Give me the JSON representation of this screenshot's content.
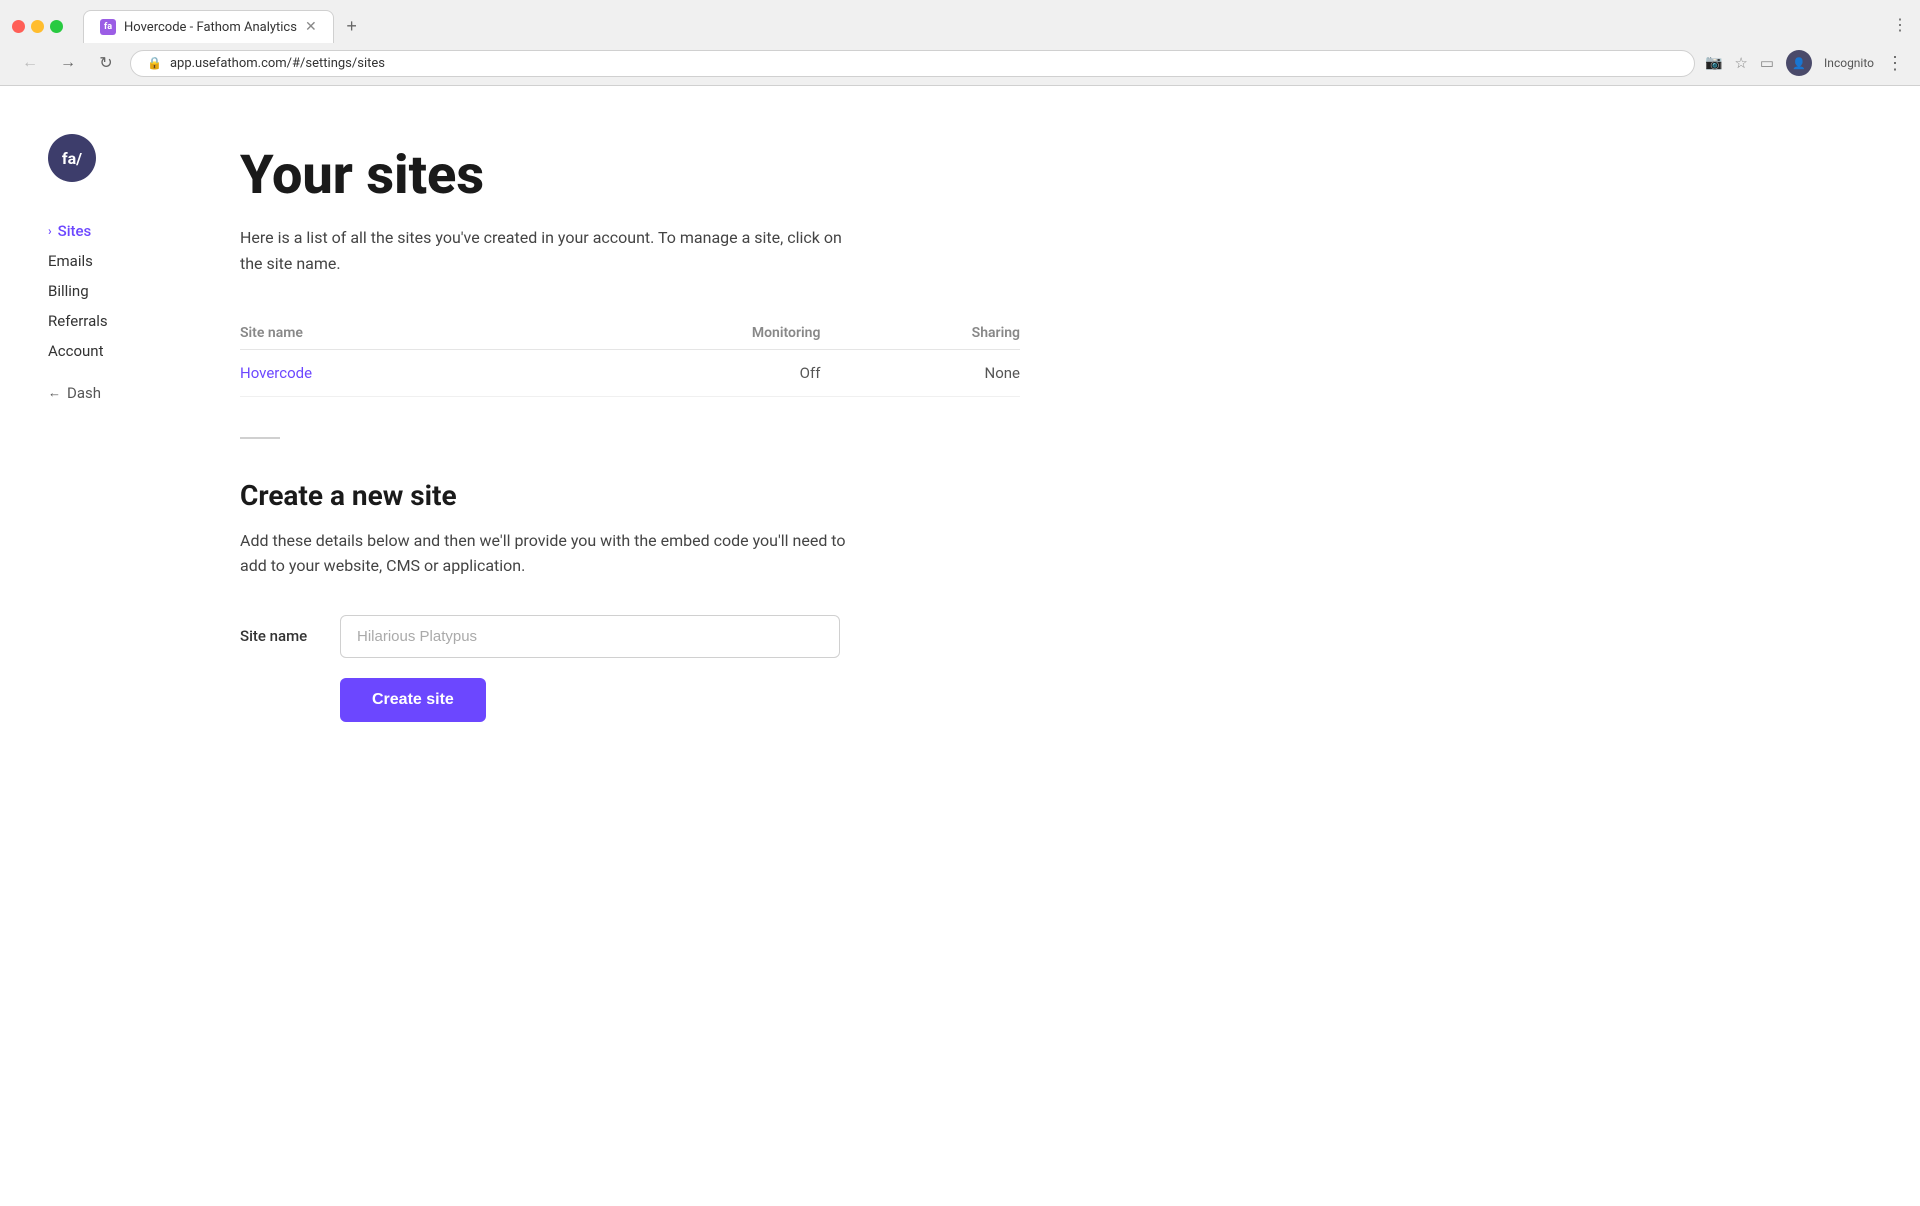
{
  "browser": {
    "tab_title": "Hovercode - Fathom Analytics",
    "url": "app.usefathom.com/#/settings/sites",
    "incognito_label": "Incognito"
  },
  "logo": {
    "text": "fa/"
  },
  "sidebar": {
    "items": [
      {
        "label": "Sites",
        "active": true,
        "has_chevron": true
      },
      {
        "label": "Emails",
        "active": false
      },
      {
        "label": "Billing",
        "active": false
      },
      {
        "label": "Referrals",
        "active": false
      },
      {
        "label": "Account",
        "active": false
      }
    ],
    "back_label": "Dash"
  },
  "main": {
    "page_title": "Your sites",
    "page_description": "Here is a list of all the sites you've created in your account. To manage a site, click on the site name.",
    "table": {
      "headers": {
        "site_name": "Site name",
        "monitoring": "Monitoring",
        "sharing": "Sharing"
      },
      "rows": [
        {
          "site_name": "Hovercode",
          "monitoring": "Off",
          "sharing": "None"
        }
      ]
    },
    "create_section": {
      "title": "Create a new site",
      "description": "Add these details below and then we'll provide you with the embed code you'll need to add to your website, CMS or application.",
      "form": {
        "site_name_label": "Site name",
        "site_name_placeholder": "Hilarious Platypus",
        "submit_button_label": "Create site"
      }
    }
  }
}
